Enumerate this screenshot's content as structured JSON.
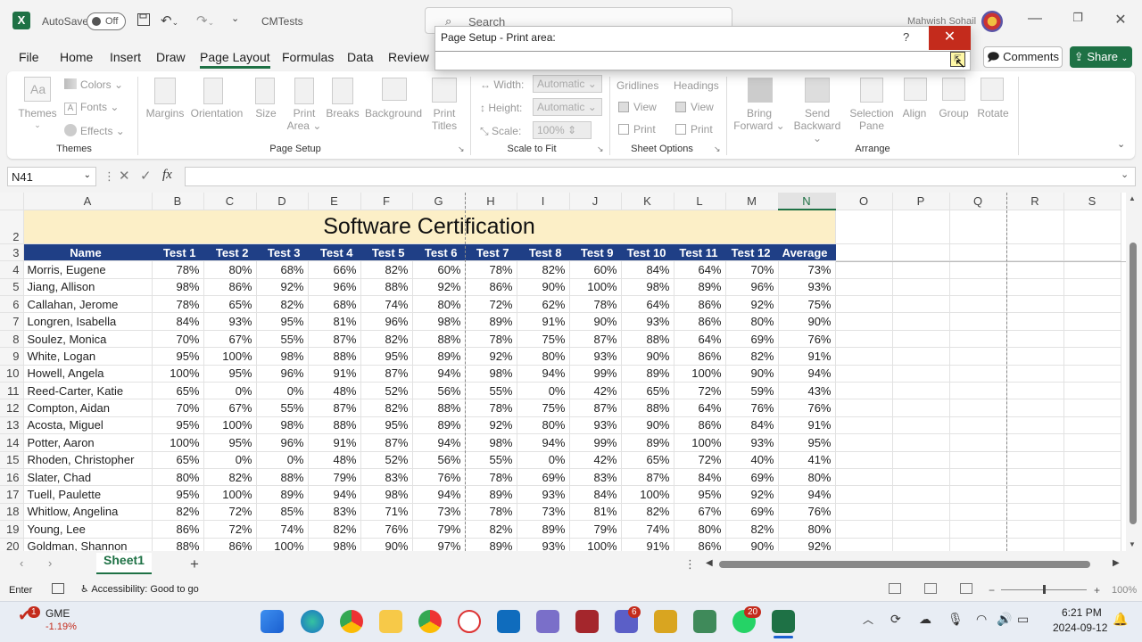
{
  "titlebar": {
    "autosave_label": "AutoSave",
    "autosave_state": "Off",
    "doc_title": "CMTests",
    "search_placeholder": "Search",
    "user": "Mahwish Sohail"
  },
  "menu": {
    "tabs": [
      "File",
      "Home",
      "Insert",
      "Draw",
      "Page Layout",
      "Formulas",
      "Data",
      "Review"
    ],
    "active": "Page Layout",
    "comments": "Comments",
    "share": "Share"
  },
  "ribbon": {
    "themes": {
      "themes": "Themes",
      "colors": "Colors",
      "fonts": "Fonts",
      "effects": "Effects",
      "group": "Themes"
    },
    "page_setup": {
      "margins": "Margins",
      "orientation": "Orientation",
      "size": "Size",
      "print_area": "Print Area",
      "print_area_1": "Print",
      "print_area_2": "Area",
      "breaks": "Breaks",
      "background": "Background",
      "print_titles_1": "Print",
      "print_titles_2": "Titles",
      "group": "Page Setup"
    },
    "scale": {
      "width": "Width:",
      "width_val": "Automatic",
      "height": "Height:",
      "height_val": "Automatic",
      "scale": "Scale:",
      "scale_val": "100%",
      "group": "Scale to Fit"
    },
    "sheet_options": {
      "gridlines": "Gridlines",
      "headings": "Headings",
      "view": "View",
      "print": "Print",
      "group": "Sheet Options"
    },
    "arrange": {
      "bring_forward_1": "Bring",
      "bring_forward_2": "Forward",
      "send_backward_1": "Send",
      "send_backward_2": "Backward",
      "selection_pane_1": "Selection",
      "selection_pane_2": "Pane",
      "align": "Align",
      "group_btn": "Group",
      "rotate": "Rotate",
      "group": "Arrange"
    }
  },
  "formula_bar": {
    "name_box": "N41",
    "fx": "fx",
    "value": ""
  },
  "dialog": {
    "title": "Page Setup - Print area:",
    "help": "?",
    "close": "✕",
    "input_value": ""
  },
  "sheet": {
    "columns": [
      "A",
      "B",
      "C",
      "D",
      "E",
      "F",
      "G",
      "H",
      "I",
      "J",
      "K",
      "L",
      "M",
      "N",
      "O",
      "P",
      "Q",
      "R",
      "S"
    ],
    "selected_column": "N",
    "title": "Software Certification",
    "headers": [
      "Name",
      "Test 1",
      "Test 2",
      "Test 3",
      "Test 4",
      "Test 5",
      "Test 6",
      "Test 7",
      "Test 8",
      "Test 9",
      "Test 10",
      "Test 11",
      "Test 12",
      "Average"
    ],
    "rows": [
      {
        "n": "4",
        "cells": [
          "Morris, Eugene",
          "78%",
          "80%",
          "68%",
          "66%",
          "82%",
          "60%",
          "78%",
          "82%",
          "60%",
          "84%",
          "64%",
          "70%",
          "73%"
        ]
      },
      {
        "n": "5",
        "cells": [
          "Jiang, Allison",
          "98%",
          "86%",
          "92%",
          "96%",
          "88%",
          "92%",
          "86%",
          "90%",
          "100%",
          "98%",
          "89%",
          "96%",
          "93%"
        ]
      },
      {
        "n": "6",
        "cells": [
          "Callahan, Jerome",
          "78%",
          "65%",
          "82%",
          "68%",
          "74%",
          "80%",
          "72%",
          "62%",
          "78%",
          "64%",
          "86%",
          "92%",
          "75%"
        ]
      },
      {
        "n": "7",
        "cells": [
          "Longren, Isabella",
          "84%",
          "93%",
          "95%",
          "81%",
          "96%",
          "98%",
          "89%",
          "91%",
          "90%",
          "93%",
          "86%",
          "80%",
          "90%"
        ]
      },
      {
        "n": "8",
        "cells": [
          "Soulez, Monica",
          "70%",
          "67%",
          "55%",
          "87%",
          "82%",
          "88%",
          "78%",
          "75%",
          "87%",
          "88%",
          "64%",
          "69%",
          "76%"
        ]
      },
      {
        "n": "9",
        "cells": [
          "White, Logan",
          "95%",
          "100%",
          "98%",
          "88%",
          "95%",
          "89%",
          "92%",
          "80%",
          "93%",
          "90%",
          "86%",
          "82%",
          "91%"
        ]
      },
      {
        "n": "10",
        "cells": [
          "Howell, Angela",
          "100%",
          "95%",
          "96%",
          "91%",
          "87%",
          "94%",
          "98%",
          "94%",
          "99%",
          "89%",
          "100%",
          "90%",
          "94%"
        ]
      },
      {
        "n": "11",
        "cells": [
          "Reed-Carter, Katie",
          "65%",
          "0%",
          "0%",
          "48%",
          "52%",
          "56%",
          "55%",
          "0%",
          "42%",
          "65%",
          "72%",
          "59%",
          "43%"
        ]
      },
      {
        "n": "12",
        "cells": [
          "Compton, Aidan",
          "70%",
          "67%",
          "55%",
          "87%",
          "82%",
          "88%",
          "78%",
          "75%",
          "87%",
          "88%",
          "64%",
          "76%",
          "76%"
        ]
      },
      {
        "n": "13",
        "cells": [
          "Acosta, Miguel",
          "95%",
          "100%",
          "98%",
          "88%",
          "95%",
          "89%",
          "92%",
          "80%",
          "93%",
          "90%",
          "86%",
          "84%",
          "91%"
        ]
      },
      {
        "n": "14",
        "cells": [
          "Potter, Aaron",
          "100%",
          "95%",
          "96%",
          "91%",
          "87%",
          "94%",
          "98%",
          "94%",
          "99%",
          "89%",
          "100%",
          "93%",
          "95%"
        ]
      },
      {
        "n": "15",
        "cells": [
          "Rhoden, Christopher",
          "65%",
          "0%",
          "0%",
          "48%",
          "52%",
          "56%",
          "55%",
          "0%",
          "42%",
          "65%",
          "72%",
          "40%",
          "41%"
        ]
      },
      {
        "n": "16",
        "cells": [
          "Slater, Chad",
          "80%",
          "82%",
          "88%",
          "79%",
          "83%",
          "76%",
          "78%",
          "69%",
          "83%",
          "87%",
          "84%",
          "69%",
          "80%"
        ]
      },
      {
        "n": "17",
        "cells": [
          "Tuell, Paulette",
          "95%",
          "100%",
          "89%",
          "94%",
          "98%",
          "94%",
          "89%",
          "93%",
          "84%",
          "100%",
          "95%",
          "92%",
          "94%"
        ]
      },
      {
        "n": "18",
        "cells": [
          "Whitlow, Angelina",
          "82%",
          "72%",
          "85%",
          "83%",
          "71%",
          "73%",
          "78%",
          "73%",
          "81%",
          "82%",
          "67%",
          "69%",
          "76%"
        ]
      },
      {
        "n": "19",
        "cells": [
          "Young, Lee",
          "86%",
          "72%",
          "74%",
          "82%",
          "76%",
          "79%",
          "82%",
          "89%",
          "79%",
          "74%",
          "80%",
          "82%",
          "80%"
        ]
      },
      {
        "n": "20",
        "cells": [
          "Goldman, Shannon",
          "88%",
          "86%",
          "100%",
          "98%",
          "90%",
          "97%",
          "89%",
          "93%",
          "100%",
          "91%",
          "86%",
          "90%",
          "92%"
        ]
      }
    ]
  },
  "sheet_tabs": {
    "tabs": [
      "Sheet1"
    ],
    "add": "+"
  },
  "status_bar": {
    "mode": "Enter",
    "accessibility": "Accessibility: Good to go",
    "zoom": "100%"
  },
  "taskbar": {
    "stock_name": "GME",
    "stock_change": "-1.19%",
    "stock_badge": "1",
    "teams_badge": "6",
    "whatsapp_badge": "20",
    "time": "6:21 PM",
    "date": "2024-09-12"
  },
  "colors": {
    "excel_green": "#1e7145",
    "header_blue": "#1f3f86",
    "title_fill": "#fcefc7",
    "close_red": "#c42b1c"
  }
}
